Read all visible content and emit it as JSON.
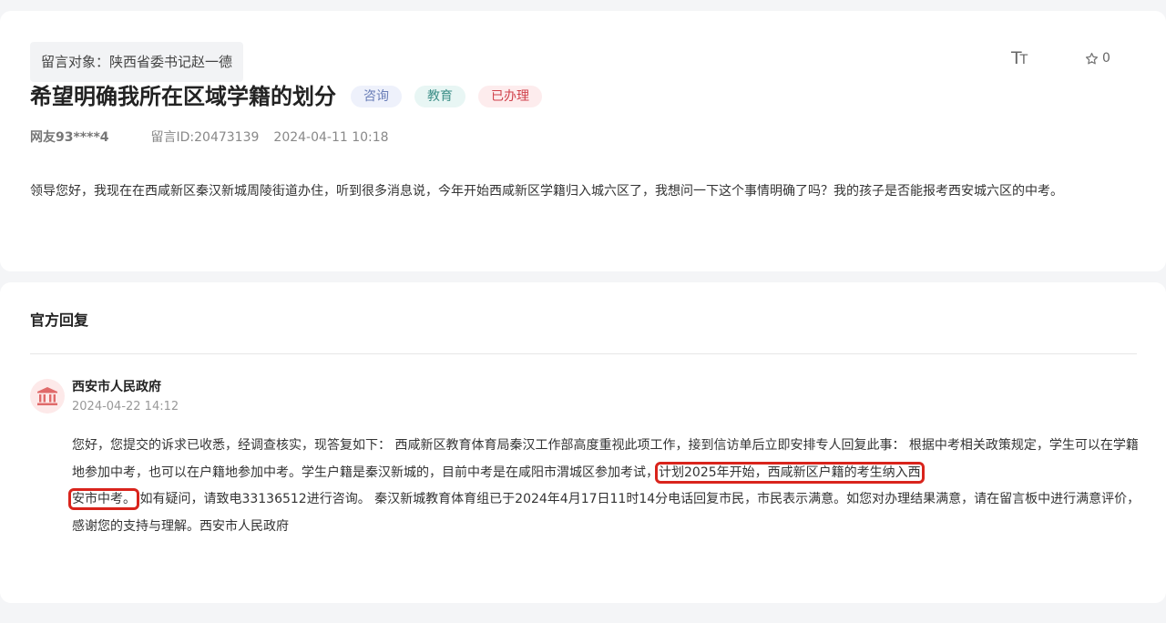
{
  "message": {
    "target": "留言对象：陕西省委书记赵一德",
    "title": "希望明确我所在区域学籍的划分",
    "badges": [
      {
        "label": "咨询",
        "bg": "#eef1fb",
        "color": "#6b7fb8"
      },
      {
        "label": "教育",
        "bg": "#e8f6f4",
        "color": "#3d8f88"
      },
      {
        "label": "已办理",
        "bg": "#fdeced",
        "color": "#d0414b"
      }
    ],
    "user": "网友93****4",
    "message_id": "留言ID:20473139",
    "date": "2024-04-11 10:18",
    "body": "领导您好，我现在在西咸新区秦汉新城周陵街道办住，听到很多消息说，今年开始西咸新区学籍归入城六区了，我想问一下这个事情明确了吗？我的孩子是否能报考西安城六区的中考。"
  },
  "toolbar": {
    "font_size_icon": "font-size-icon",
    "favorite_icon": "star-icon",
    "favorite_count": "0"
  },
  "reply": {
    "section_title": "官方回复",
    "org": "西安市人民政府",
    "date": "2024-04-22 14:12",
    "avatar_icon": "government-building-icon",
    "body_before": "您好，您提交的诉求已收悉，经调查核实，现答复如下： 西咸新区教育体育局秦汉工作部高度重视此项工作，接到信访单后立即安排专人回复此事： 根据中考相关政策规定，学生可以在学籍地参加中考，也可以在户籍地参加中考。学生户籍是秦汉新城的，目前中考是在咸阳市渭城区参加考试，",
    "highlight_part1": "计划2025年开始，西咸新区户籍的考生纳入西",
    "highlight_part2": "安市中考。",
    "body_after": "如有疑问，请致电33136512进行咨询。 秦汉新城教育体育组已于2024年4月17日11时14分电话回复市民，市民表示满意。如您对办理结果满意，请在留言板中进行满意评价，感谢您的支持与理解。西安市人民政府"
  },
  "colors": {
    "highlight_border": "#d9241c",
    "avatar_bg": "#fde9e9",
    "avatar_icon": "#e06a6a"
  }
}
